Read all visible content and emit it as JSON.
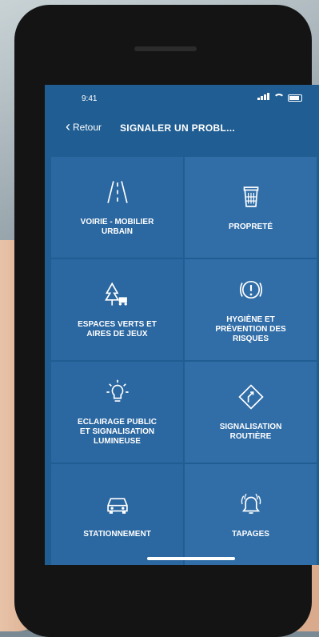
{
  "status_bar": {
    "time": "9:41"
  },
  "nav": {
    "back_label": "Retour",
    "title": "SIGNALER UN PROBL..."
  },
  "tiles": [
    {
      "label": "VOIRIE - MOBILIER\nURBAIN",
      "icon": "road-icon"
    },
    {
      "label": "PROPRETÉ",
      "icon": "trash-icon"
    },
    {
      "label": "ESPACES VERTS ET\nAIRES DE JEUX",
      "icon": "tree-icon"
    },
    {
      "label": "HYGIÈNE ET\nPRÉVENTION DES\nRISQUES",
      "icon": "warning-icon"
    },
    {
      "label": "ECLAIRAGE PUBLIC\nET SIGNALISATION\nLUMINEUSE",
      "icon": "lightbulb-icon"
    },
    {
      "label": "SIGNALISATION\nROUTIÈRE",
      "icon": "road-sign-icon"
    },
    {
      "label": "STATIONNEMENT",
      "icon": "car-icon"
    },
    {
      "label": "TAPAGES",
      "icon": "alarm-bell-icon"
    }
  ]
}
